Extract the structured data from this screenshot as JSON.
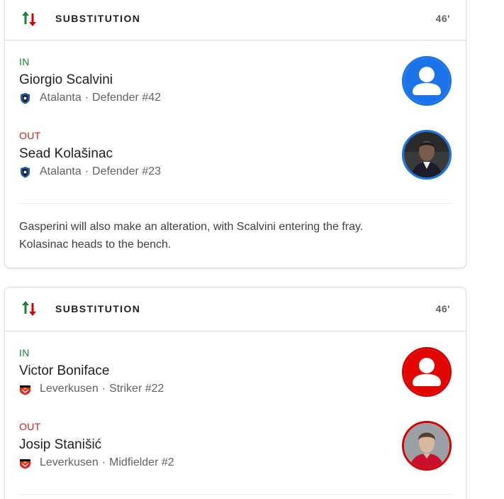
{
  "events": [
    {
      "title": "SUBSTITUTION",
      "minute": "46'",
      "in": {
        "tag": "IN",
        "name": "Giorgio Scalvini",
        "team": "Atalanta",
        "role": "Defender #42",
        "avatar": "placeholder-person-icon"
      },
      "out": {
        "tag": "OUT",
        "name": "Sead Kolašinac",
        "team": "Atalanta",
        "role": "Defender #23",
        "avatar": "player-photo"
      },
      "comment": "Gasperini will also make an alteration, with Scalvini entering the fray. Kolasinac heads to the bench.",
      "accent": "#1a73e8"
    },
    {
      "title": "SUBSTITUTION",
      "minute": "46'",
      "in": {
        "tag": "IN",
        "name": "Victor Boniface",
        "team": "Leverkusen",
        "role": "Striker #22",
        "avatar": "placeholder-person-icon"
      },
      "out": {
        "tag": "OUT",
        "name": "Josip Stanišić",
        "team": "Leverkusen",
        "role": "Midfielder #2",
        "avatar": "player-photo"
      },
      "accent": "#d50000"
    }
  ],
  "separator": "·",
  "colors": {
    "in": "#188038",
    "out": "#c5221f",
    "arrow_up": "#188038",
    "arrow_down": "#d50000"
  }
}
